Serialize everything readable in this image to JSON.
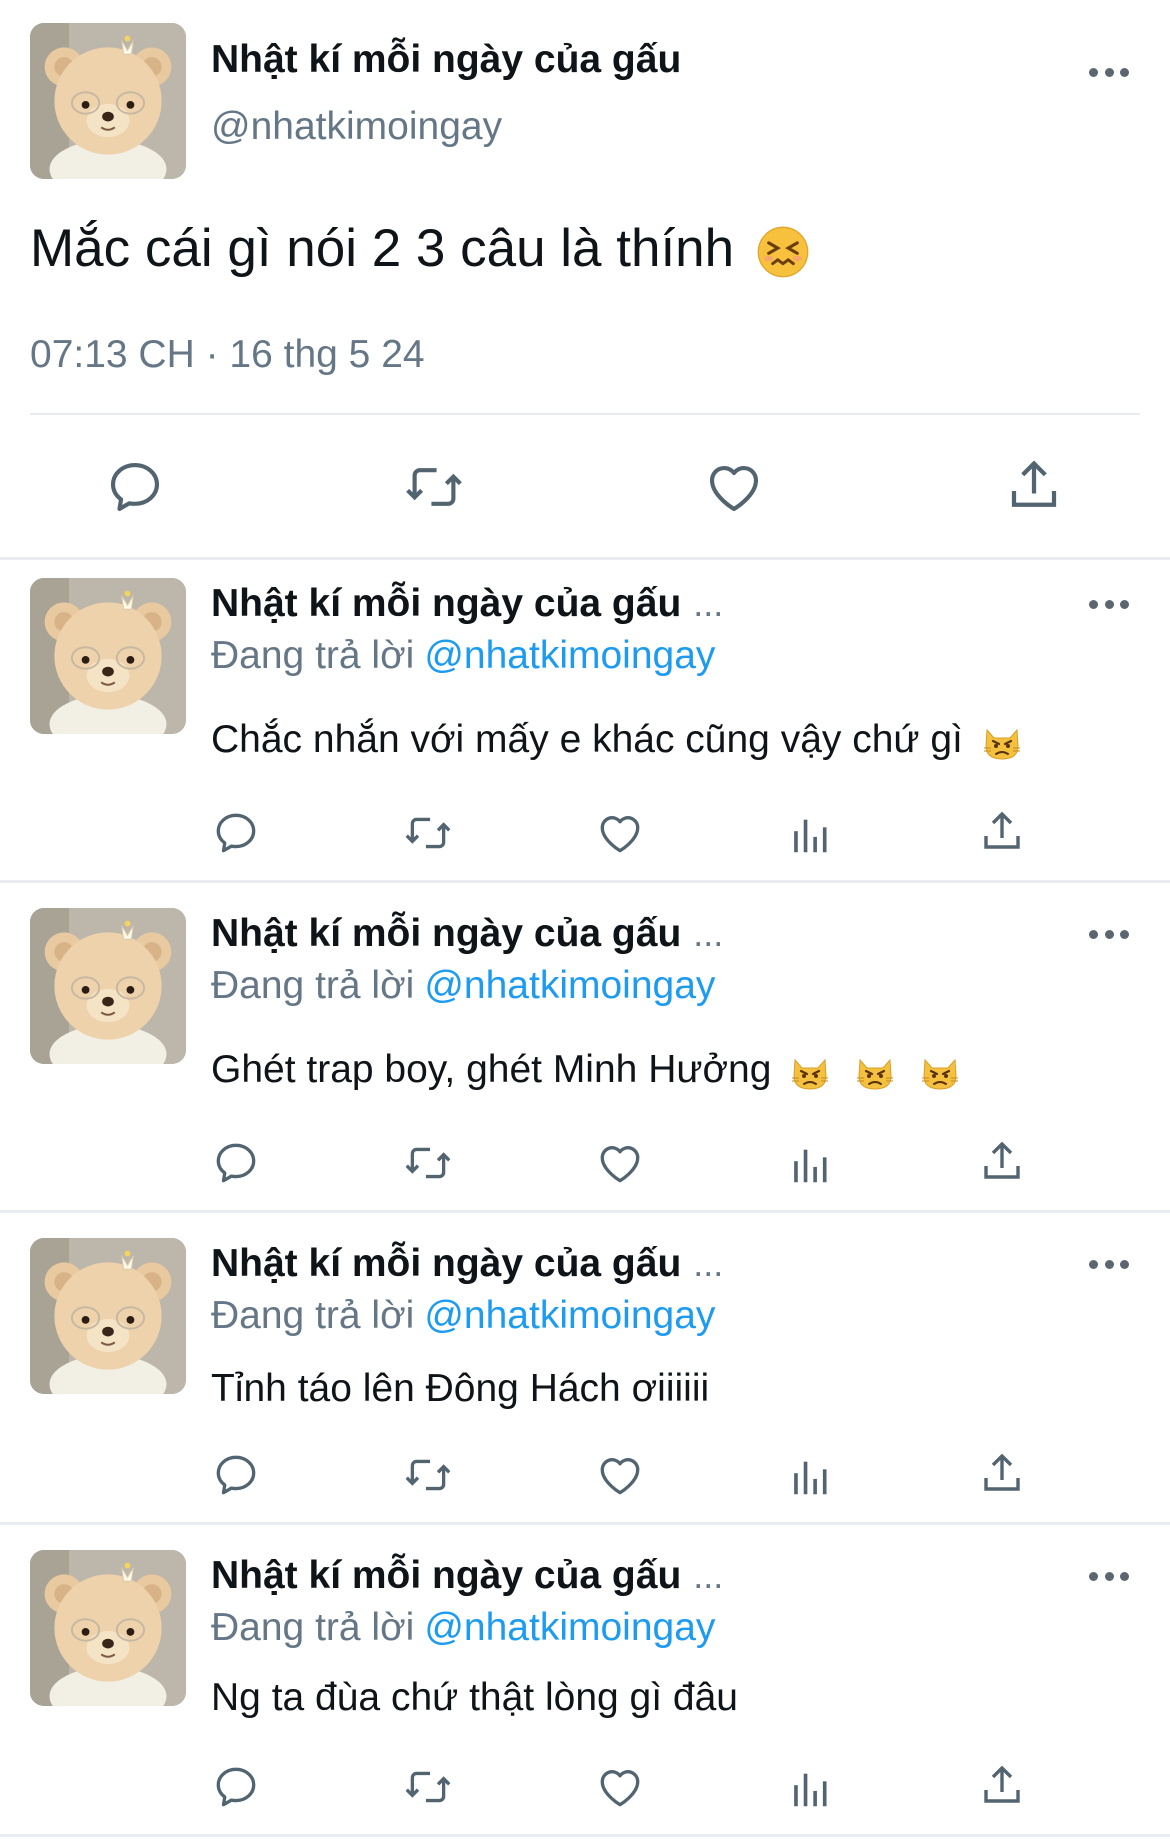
{
  "main_tweet": {
    "author_name": "Nhật kí mỗi ngày của gấu",
    "handle": "@nhatkimoingay",
    "text": "Mắc cái gì nói 2 3 câu là thính",
    "emoji": "confounded-face",
    "timestamp": "07:13 CH · 16 thg 5 24"
  },
  "replies": [
    {
      "author_name": "Nhật kí mỗi ngày của gấu",
      "ellipsis": "...",
      "replying_label": "Đang trả lời",
      "mention": "@nhatkimoingay",
      "text": "Chắc nhắn với mấy e khác cũng vậy chứ gì",
      "emoji_count": 1
    },
    {
      "author_name": "Nhật kí mỗi ngày của gấu",
      "ellipsis": "...",
      "replying_label": "Đang trả lời",
      "mention": "@nhatkimoingay",
      "text": "Ghét trap boy, ghét Minh Hưởng",
      "emoji_count": 3
    },
    {
      "author_name": "Nhật kí mỗi ngày của gấu",
      "ellipsis": "...",
      "replying_label": "Đang trả lời",
      "mention": "@nhatkimoingay",
      "text": "Tỉnh táo lên Đông Hách ơiiiiii",
      "emoji_count": 0
    },
    {
      "author_name": "Nhật kí mỗi ngày của gấu",
      "ellipsis": "...",
      "replying_label": "Đang trả lời",
      "mention": "@nhatkimoingay",
      "text": "Ng ta đùa chứ thật lòng gì đâu",
      "emoji_count": 0
    }
  ],
  "reply_emoji": "pouting-cat-face",
  "icons": [
    "reply-icon",
    "retweet-icon",
    "like-icon",
    "analytics-icon",
    "share-icon",
    "more-icon"
  ],
  "colors": {
    "text": "#0f1419",
    "secondary": "#657786",
    "mention": "#1d9bf0",
    "divider": "#e6ecf0",
    "icon": "#536471"
  }
}
